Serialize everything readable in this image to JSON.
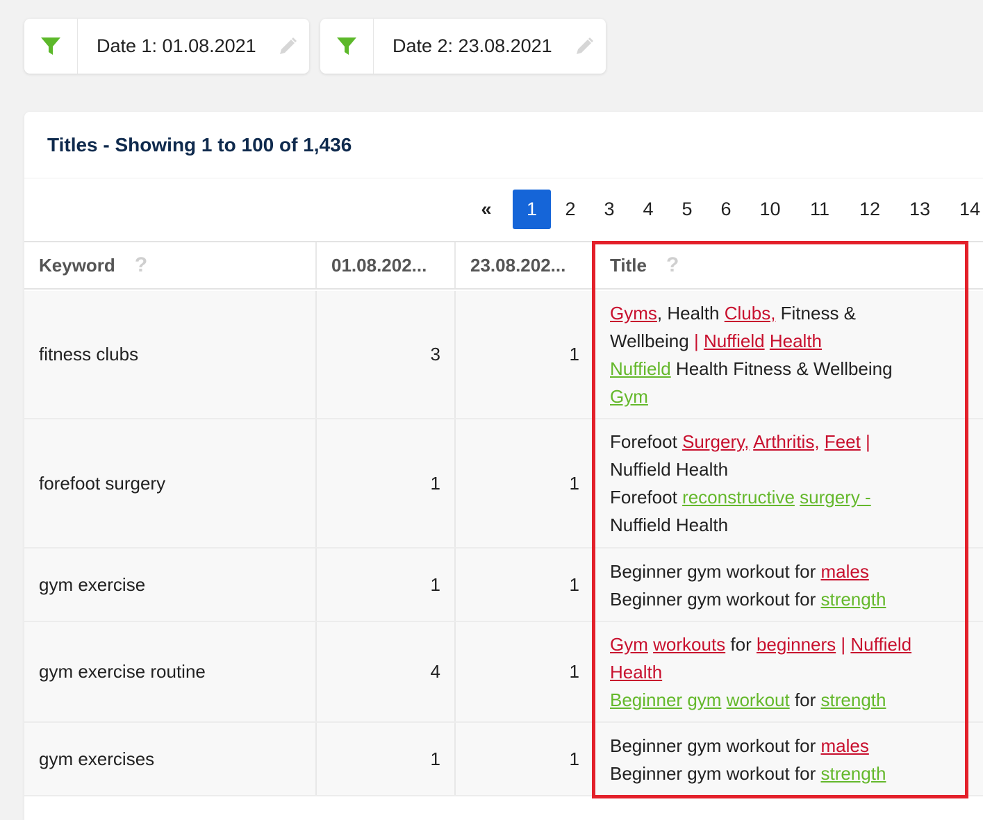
{
  "filters": [
    {
      "label": "Date 1: 01.08.2021"
    },
    {
      "label": "Date 2: 23.08.2021"
    }
  ],
  "card": {
    "title": "Titles - Showing 1 to 100 of 1,436"
  },
  "pagination": {
    "first": "«",
    "pages": [
      "1",
      "2",
      "3",
      "4",
      "5",
      "6",
      "10",
      "11",
      "12",
      "13",
      "14"
    ],
    "active": "1"
  },
  "columns": {
    "keyword": "Keyword",
    "date1": "01.08.202...",
    "date2": "23.08.202...",
    "title": "Title",
    "help": "?"
  },
  "rows": [
    {
      "keyword": "fitness clubs",
      "d1": "3",
      "d2": "1",
      "title_lines": [
        [
          {
            "t": "Gyms",
            "c": "r"
          },
          {
            "t": ", Health "
          },
          {
            "t": "Clubs,",
            "c": "r"
          },
          {
            "t": " Fitness &"
          }
        ],
        [
          {
            "t": "Wellbeing "
          },
          {
            "t": "|",
            "c": "rn"
          },
          {
            "t": " "
          },
          {
            "t": "Nuffield",
            "c": "r"
          },
          {
            "t": " "
          },
          {
            "t": "Health",
            "c": "r"
          }
        ],
        [
          {
            "t": "Nuffield",
            "c": "g"
          },
          {
            "t": " Health Fitness & Wellbeing"
          }
        ],
        [
          {
            "t": "Gym",
            "c": "g"
          }
        ]
      ]
    },
    {
      "keyword": "forefoot surgery",
      "d1": "1",
      "d2": "1",
      "title_lines": [
        [
          {
            "t": "Forefoot "
          },
          {
            "t": "Surgery,",
            "c": "r"
          },
          {
            "t": " "
          },
          {
            "t": "Arthritis,",
            "c": "r"
          },
          {
            "t": " "
          },
          {
            "t": "Feet",
            "c": "r"
          },
          {
            "t": " "
          },
          {
            "t": "|",
            "c": "rn"
          }
        ],
        [
          {
            "t": "Nuffield Health"
          }
        ],
        [
          {
            "t": "Forefoot "
          },
          {
            "t": "reconstructive",
            "c": "g"
          },
          {
            "t": " "
          },
          {
            "t": "surgery -",
            "c": "g"
          }
        ],
        [
          {
            "t": "Nuffield Health"
          }
        ]
      ]
    },
    {
      "keyword": "gym exercise",
      "d1": "1",
      "d2": "1",
      "title_lines": [
        [
          {
            "t": "Beginner gym workout for "
          },
          {
            "t": "males",
            "c": "r"
          }
        ],
        [
          {
            "t": "Beginner gym workout for "
          },
          {
            "t": "strength",
            "c": "g"
          }
        ]
      ]
    },
    {
      "keyword": "gym exercise routine",
      "d1": "4",
      "d2": "1",
      "title_lines": [
        [
          {
            "t": "Gym",
            "c": "r"
          },
          {
            "t": " "
          },
          {
            "t": "workouts",
            "c": "r"
          },
          {
            "t": " for "
          },
          {
            "t": "beginners",
            "c": "r"
          },
          {
            "t": " "
          },
          {
            "t": "|",
            "c": "rn"
          },
          {
            "t": " "
          },
          {
            "t": "Nuffield",
            "c": "r"
          }
        ],
        [
          {
            "t": "Health",
            "c": "r"
          }
        ],
        [
          {
            "t": "Beginner",
            "c": "g"
          },
          {
            "t": " "
          },
          {
            "t": "gym",
            "c": "g"
          },
          {
            "t": " "
          },
          {
            "t": "workout",
            "c": "g"
          },
          {
            "t": " for "
          },
          {
            "t": "strength",
            "c": "g"
          }
        ]
      ]
    },
    {
      "keyword": "gym exercises",
      "d1": "1",
      "d2": "1",
      "title_lines": [
        [
          {
            "t": "Beginner gym workout for "
          },
          {
            "t": "males",
            "c": "r"
          }
        ],
        [
          {
            "t": "Beginner gym workout for "
          },
          {
            "t": "strength",
            "c": "g"
          }
        ]
      ]
    }
  ],
  "colors": {
    "accent": "#1565d8",
    "removed": "#c8102e",
    "added": "#64b82b",
    "highlight": "#e3202a",
    "filter_icon": "#5cb82a"
  }
}
